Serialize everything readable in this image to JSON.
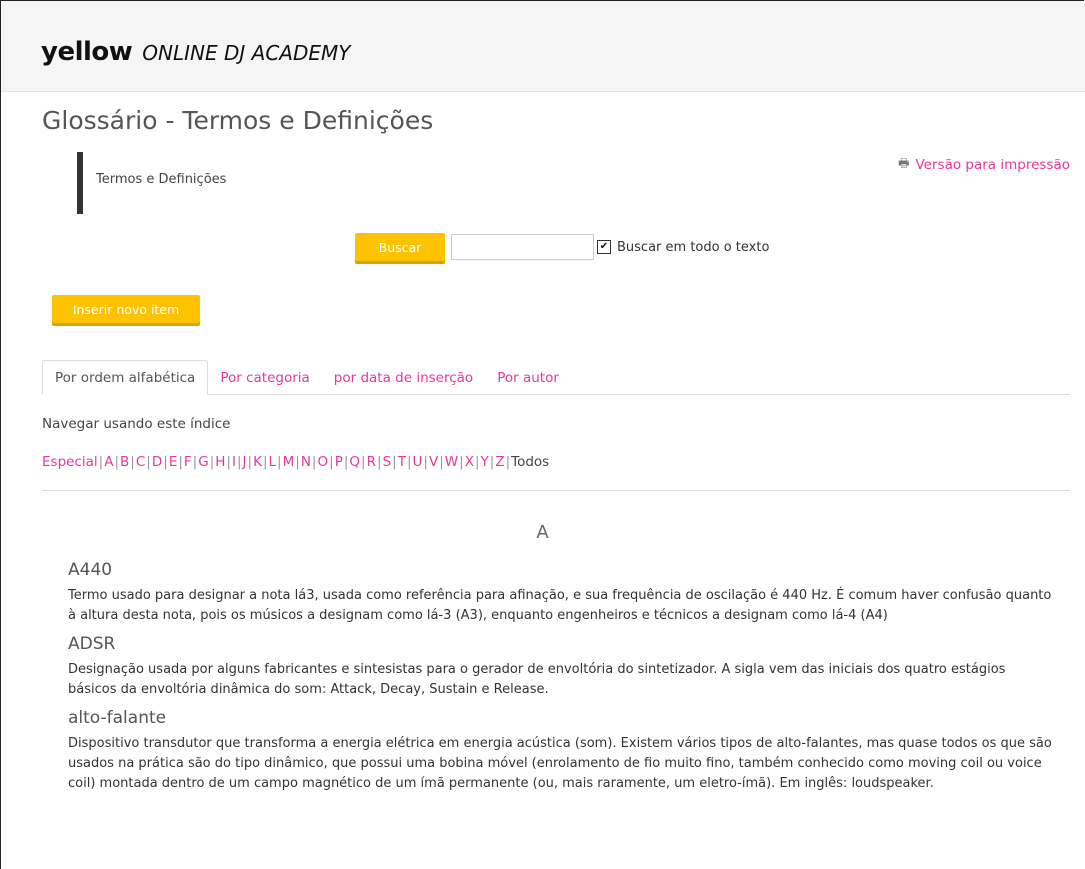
{
  "header": {
    "brand": "yellow",
    "subtitle": "ONLINE DJ ACADEMY"
  },
  "page_title": "Glossário - Termos e Definições",
  "intro_text": "Termos e Definições",
  "print_link": {
    "icon": "printer-icon",
    "label": "Versão para impressão"
  },
  "search": {
    "button_label": "Buscar",
    "input_value": "",
    "checkbox_checked": true,
    "checkbox_label": "Buscar em todo o texto"
  },
  "insert_button_label": "Inserir novo item",
  "tabs": [
    {
      "label": "Por ordem alfabética",
      "active": true
    },
    {
      "label": "Por categoria",
      "active": false
    },
    {
      "label": "por data de inserção",
      "active": false
    },
    {
      "label": "Por autor",
      "active": false
    }
  ],
  "nav_label": "Navegar usando este índice",
  "index": [
    "Especial",
    "A",
    "B",
    "C",
    "D",
    "E",
    "F",
    "G",
    "H",
    "I",
    "J",
    "K",
    "L",
    "M",
    "N",
    "O",
    "P",
    "Q",
    "R",
    "S",
    "T",
    "U",
    "V",
    "W",
    "X",
    "Y",
    "Z",
    "Todos"
  ],
  "current_letter": "A",
  "entries": [
    {
      "term": "A440",
      "definition": "Termo usado para designar a nota lá3, usada como referência para afinação, e sua frequência de oscilação é 440 Hz. É comum haver confusão quanto à altura desta nota, pois os músicos a designam como lá-3 (A3), enquanto engenheiros e técnicos a designam como lá-4 (A4)"
    },
    {
      "term": "ADSR",
      "definition": "Designação usada por alguns fabricantes e sintesistas para o gerador de envoltória do sintetizador. A sigla vem das iniciais dos quatro estágios básicos da envoltória dinâmica do som: Attack, Decay, Sustain e Release."
    },
    {
      "term": "alto-falante",
      "definition": "Dispositivo transdutor que transforma a energia elétrica em energia acústica (som). Existem vários tipos de alto-falantes, mas quase todos os que são usados na prática são do tipo dinâmico, que possui uma bobina móvel (enrolamento de fio muito fino, também conhecido como moving coil ou voice coil) montada dentro de um campo magnético de um ímã permanente (ou, mais raramente, um eletro-ímã). Em inglês: loudspeaker."
    }
  ],
  "colors": {
    "accent": "#e6379d",
    "button": "#fdc300"
  }
}
